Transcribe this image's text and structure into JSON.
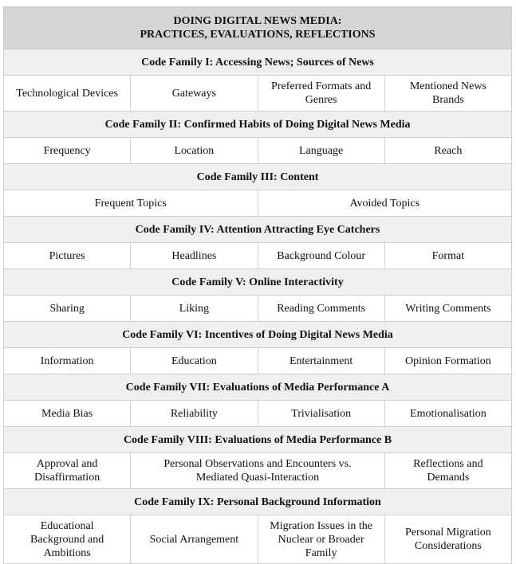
{
  "title": {
    "line1": "DOING DIGITAL NEWS MEDIA:",
    "line2": "PRACTICES, EVALUATIONS, REFLECTIONS"
  },
  "families": [
    {
      "heading": "Code Family I: Accessing News; Sources of News",
      "codes": [
        "Technological Devices",
        "Gateways",
        "Preferred Formats and Genres",
        "Mentioned News Brands"
      ]
    },
    {
      "heading": "Code Family II: Confirmed Habits of Doing Digital News Media",
      "codes": [
        "Frequency",
        "Location",
        "Language",
        "Reach"
      ]
    },
    {
      "heading": "Code Family III: Content",
      "codes": [
        "Frequent Topics",
        "Avoided Topics"
      ]
    },
    {
      "heading": "Code Family IV: Attention Attracting Eye Catchers",
      "codes": [
        "Pictures",
        "Headlines",
        "Background Colour",
        "Format"
      ]
    },
    {
      "heading": "Code Family V: Online Interactivity",
      "codes": [
        "Sharing",
        "Liking",
        "Reading Comments",
        "Writing Comments"
      ]
    },
    {
      "heading": "Code Family VI: Incentives of Doing Digital News Media",
      "codes": [
        "Information",
        "Education",
        "Entertainment",
        "Opinion Formation"
      ]
    },
    {
      "heading": "Code Family VII: Evaluations of Media Performance A",
      "codes": [
        "Media Bias",
        "Reliability",
        "Trivialisation",
        "Emotionalisation"
      ]
    },
    {
      "heading": "Code Family VIII: Evaluations of Media Performance B",
      "codes": [
        "Approval and Disaffirmation",
        "Personal Observations and Encounters vs. Mediated Quasi-Interaction",
        "Reflections and Demands"
      ]
    },
    {
      "heading": "Code Family IX: Personal Background Information",
      "codes": [
        "Educational Background and Ambitions",
        "Social Arrangement",
        "Migration Issues in the Nuclear or Broader Family",
        "Personal Migration Considerations"
      ]
    }
  ]
}
